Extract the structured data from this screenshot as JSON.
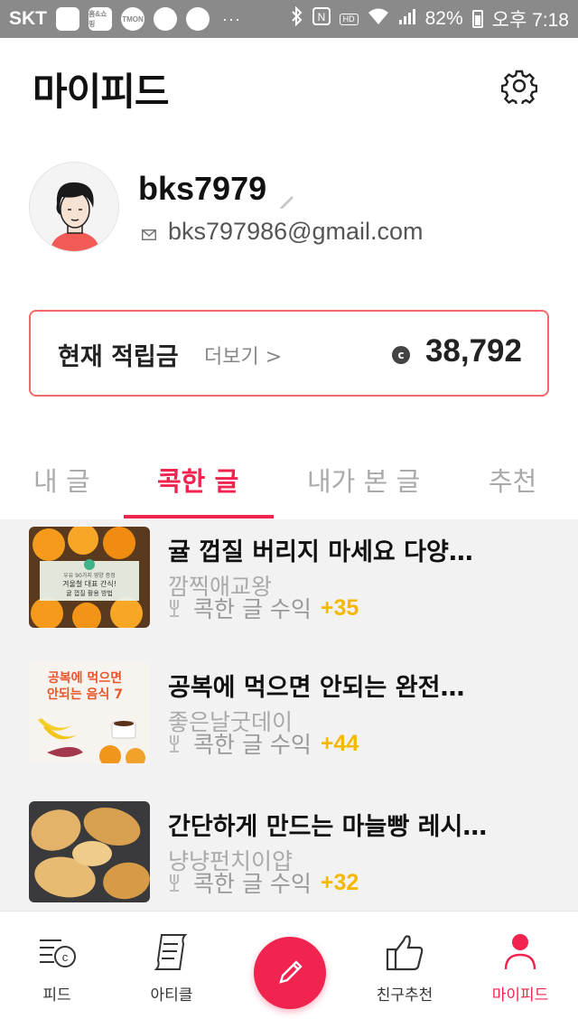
{
  "status_bar": {
    "carrier": "SKT",
    "app_icons": [
      "gallery-icon",
      "nongshim-icon",
      "tmon-icon",
      "chat-icon",
      "message-icon"
    ],
    "app_icon_labels": [
      "",
      "홈&쇼핑",
      "TMON",
      "",
      ""
    ],
    "more": "···",
    "hd_voice": "HD",
    "battery_percent": "82%",
    "time": "오후 7:18"
  },
  "header": {
    "title": "마이피드",
    "settings_icon": "gear-icon"
  },
  "profile": {
    "username": "bks7979",
    "email": "bks797986@gmail.com"
  },
  "points": {
    "label": "현재 적립금",
    "more_link": "더보기 >",
    "coin_symbol": "c",
    "value": "38,792"
  },
  "tabs": [
    {
      "label": "내 글",
      "active": false
    },
    {
      "label": "콕한 글",
      "active": true
    },
    {
      "label": "내가 본 글",
      "active": false
    },
    {
      "label": "추천",
      "active": false
    }
  ],
  "articles": [
    {
      "title": "귤 껍질 버리지 마세요 다양…",
      "author": "깜찍애교왕",
      "stat_label": "콕한 글  수익",
      "earnings": "+35",
      "thumb": "tangerine-thumbnail"
    },
    {
      "title": "공복에 먹으면 안되는 완전…",
      "author": "좋은날굿데이",
      "stat_label": "콕한 글  수익",
      "earnings": "+44",
      "thumb": "empty-stomach-food-thumbnail"
    },
    {
      "title": "간단하게 만드는 마늘빵 레시…",
      "author": "냥냥펀치이얍",
      "stat_label": "콕한 글  수익",
      "earnings": "+32",
      "thumb": "garlic-bread-thumbnail"
    }
  ],
  "thumb_text": {
    "first_caption_line1": "우유 90가지 영양 증정",
    "first_caption_line2": "겨울철 대표 간식!",
    "first_caption_line3": "귤 껍질 활용 방법",
    "second_line1": "공복에 먹으면",
    "second_line2": "안되는 음식 7"
  },
  "bottom_nav": [
    {
      "label": "피드",
      "icon": "feed-icon",
      "active": false
    },
    {
      "label": "아티클",
      "icon": "article-icon",
      "active": false
    },
    {
      "label": "",
      "icon": "pencil-icon",
      "active": false
    },
    {
      "label": "친구추천",
      "icon": "thumbs-up-icon",
      "active": false
    },
    {
      "label": "마이피드",
      "icon": "person-icon",
      "active": true
    }
  ],
  "colors": {
    "accent": "#f0244f",
    "earnings": "#f5b800",
    "card_border": "#f26a6a"
  }
}
